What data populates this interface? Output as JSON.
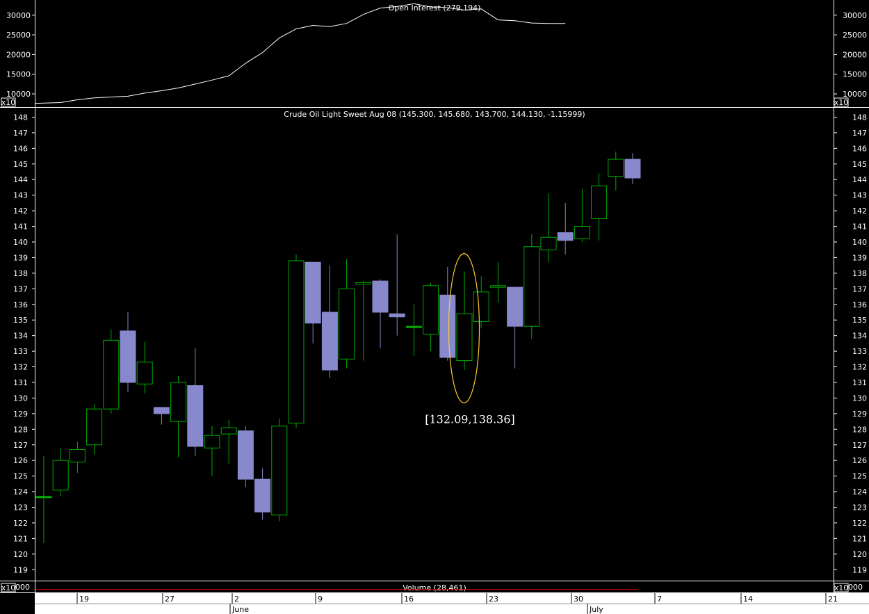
{
  "chart_data": [
    {
      "type": "line",
      "title": "Open Interest (279,194)",
      "scale_badge": "x10",
      "yticks": [
        10000,
        15000,
        20000,
        25000,
        30000
      ],
      "ylim": [
        7000,
        33500
      ],
      "x_index": [
        0,
        1,
        2,
        3,
        4,
        5,
        6,
        7,
        8,
        9,
        10,
        11,
        12,
        13,
        14,
        15,
        16,
        17,
        18,
        19,
        20,
        21,
        22,
        23,
        24,
        25,
        26,
        27,
        28,
        29,
        30,
        31,
        32,
        33,
        34,
        35
      ],
      "values": [
        7600,
        7800,
        8500,
        9000,
        9200,
        9400,
        10200,
        10800,
        11500,
        12500,
        13500,
        14600,
        17800,
        20500,
        24200,
        26500,
        27400,
        27100,
        27900,
        30200,
        31800,
        32200,
        32900,
        32100,
        31900,
        31300,
        31600,
        28800,
        28600,
        28000,
        27900,
        27900,
        null,
        null,
        null,
        null
      ]
    },
    {
      "type": "candlestick",
      "title": "Crude Oil Light Sweet Aug 08 (145.300, 145.680, 143.700, 144.130, -1.15999)",
      "yticks": [
        119,
        120,
        121,
        122,
        123,
        124,
        125,
        126,
        127,
        128,
        129,
        130,
        131,
        132,
        133,
        134,
        135,
        136,
        137,
        138,
        139,
        140,
        141,
        142,
        143,
        144,
        145,
        146,
        147,
        148
      ],
      "ylim": [
        118.3,
        148.6
      ],
      "candles": [
        {
          "o": 123.7,
          "h": 126.3,
          "l": 120.7,
          "c": 123.7
        },
        {
          "o": 124.1,
          "h": 126.8,
          "l": 123.7,
          "c": 126.0
        },
        {
          "o": 125.9,
          "h": 127.2,
          "l": 125.2,
          "c": 126.7
        },
        {
          "o": 127.0,
          "h": 129.6,
          "l": 126.4,
          "c": 129.3
        },
        {
          "o": 129.3,
          "h": 134.4,
          "l": 129.0,
          "c": 133.7
        },
        {
          "o": 134.3,
          "h": 135.5,
          "l": 130.4,
          "c": 131.0
        },
        {
          "o": 130.9,
          "h": 133.6,
          "l": 130.3,
          "c": 132.3
        },
        {
          "o": 129.4,
          "h": 129.4,
          "l": 128.3,
          "c": 129.0
        },
        {
          "o": 128.5,
          "h": 131.4,
          "l": 126.2,
          "c": 131.0
        },
        {
          "o": 130.8,
          "h": 133.2,
          "l": 126.3,
          "c": 126.9
        },
        {
          "o": 126.8,
          "h": 128.2,
          "l": 125.0,
          "c": 127.6
        },
        {
          "o": 127.7,
          "h": 128.6,
          "l": 125.8,
          "c": 128.1
        },
        {
          "o": 127.9,
          "h": 128.2,
          "l": 124.3,
          "c": 124.8
        },
        {
          "o": 124.8,
          "h": 125.5,
          "l": 122.2,
          "c": 122.7
        },
        {
          "o": 122.5,
          "h": 128.7,
          "l": 122.1,
          "c": 128.2
        },
        {
          "o": 128.4,
          "h": 139.2,
          "l": 128.1,
          "c": 138.8
        },
        {
          "o": 138.7,
          "h": 138.7,
          "l": 133.5,
          "c": 134.8
        },
        {
          "o": 135.5,
          "h": 138.5,
          "l": 131.3,
          "c": 131.8
        },
        {
          "o": 132.5,
          "h": 138.9,
          "l": 131.9,
          "c": 137.0
        },
        {
          "o": 137.3,
          "h": 137.5,
          "l": 132.4,
          "c": 137.4
        },
        {
          "o": 137.5,
          "h": 137.6,
          "l": 133.2,
          "c": 135.5
        },
        {
          "o": 135.4,
          "h": 140.5,
          "l": 134.0,
          "c": 135.2
        },
        {
          "o": 134.6,
          "h": 136.0,
          "l": 132.7,
          "c": 134.6
        },
        {
          "o": 134.1,
          "h": 137.4,
          "l": 133.0,
          "c": 137.2
        },
        {
          "o": 136.6,
          "h": 138.4,
          "l": 132.4,
          "c": 132.6
        },
        {
          "o": 132.4,
          "h": 138.1,
          "l": 131.8,
          "c": 135.4
        },
        {
          "o": 134.9,
          "h": 137.8,
          "l": 134.5,
          "c": 136.8
        },
        {
          "o": 137.1,
          "h": 138.7,
          "l": 136.1,
          "c": 137.2
        },
        {
          "o": 137.1,
          "h": 137.1,
          "l": 131.9,
          "c": 134.6
        },
        {
          "o": 134.6,
          "h": 140.5,
          "l": 133.8,
          "c": 139.7
        },
        {
          "o": 139.5,
          "h": 143.1,
          "l": 138.7,
          "c": 140.3
        },
        {
          "o": 140.6,
          "h": 142.5,
          "l": 139.2,
          "c": 140.1
        },
        {
          "o": 140.2,
          "h": 143.4,
          "l": 140.0,
          "c": 141.0
        },
        {
          "o": 141.5,
          "h": 144.4,
          "l": 140.1,
          "c": 143.6
        },
        {
          "o": 144.2,
          "h": 145.8,
          "l": 143.3,
          "c": 145.3
        },
        {
          "o": 145.3,
          "h": 145.7,
          "l": 143.7,
          "c": 144.1
        }
      ],
      "annotation": {
        "text": "[132.09,138.36]",
        "candle_index": 25,
        "low": 132.09,
        "high": 138.36
      }
    },
    {
      "type": "bar",
      "title": "Volume (28,461)",
      "scale_badge": "x10",
      "ytick_label": "000"
    }
  ],
  "x_axis": {
    "day_ticks": [
      "19",
      "27",
      "2",
      "9",
      "16",
      "23",
      "30",
      "7",
      "14",
      "21"
    ],
    "months": [
      "June",
      "July"
    ]
  },
  "colors": {
    "background": "#000000",
    "up_candle": "#00aa00",
    "down_candle": "#8888cc",
    "line": "#ffffff",
    "annotation": "#ffcc33",
    "volume_line": "#cc0000",
    "axis_panel": "#ffffff"
  }
}
